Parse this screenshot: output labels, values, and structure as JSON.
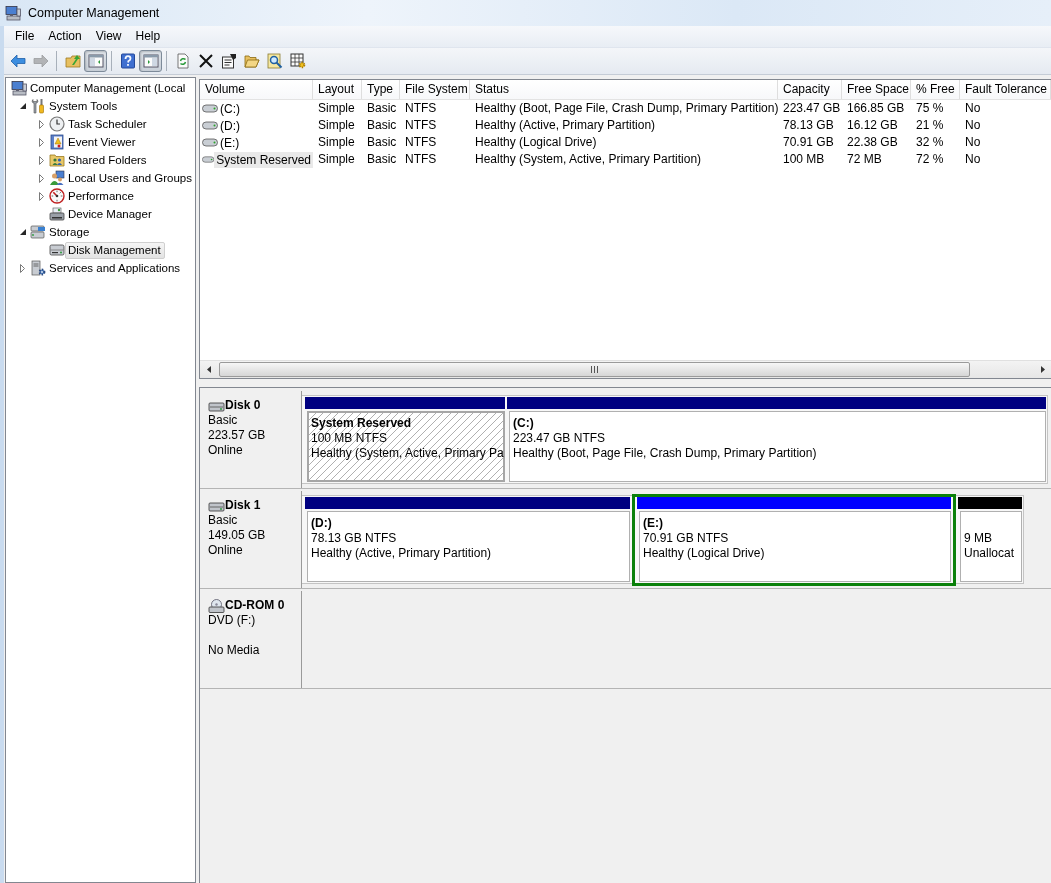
{
  "window": {
    "title": "Computer Management"
  },
  "menu": [
    "File",
    "Action",
    "View",
    "Help"
  ],
  "toolbar": [
    {
      "buttons": [
        {
          "pressed": false,
          "disabled": false
        },
        {
          "pressed": false,
          "disabled": true
        }
      ]
    },
    {
      "buttons": [
        {
          "pressed": false,
          "disabled": false
        },
        {
          "pressed": true,
          "disabled": false
        }
      ]
    },
    {
      "buttons": [
        {
          "pressed": false,
          "disabled": false
        },
        {
          "pressed": true,
          "disabled": false
        }
      ]
    },
    {
      "buttons": [
        {
          "pressed": false,
          "disabled": false
        },
        {
          "pressed": false,
          "disabled": false
        },
        {
          "pressed": false,
          "disabled": false
        },
        {
          "pressed": false,
          "disabled": false
        },
        {
          "pressed": false,
          "disabled": false
        },
        {
          "pressed": false,
          "disabled": false
        }
      ]
    }
  ],
  "tree": [
    {
      "label": "Computer Management (Local",
      "kind": "computer",
      "selected": false,
      "children": [
        {
          "label": "System Tools",
          "kind": "tools",
          "expanded": true,
          "selected": false,
          "children": [
            {
              "label": "Task Scheduler",
              "kind": "clock",
              "expanded": false,
              "selected": false
            },
            {
              "label": "Event Viewer",
              "kind": "log",
              "expanded": false,
              "selected": false
            },
            {
              "label": "Shared Folders",
              "kind": "shared-folder",
              "expanded": false,
              "selected": false
            },
            {
              "label": "Local Users and Groups",
              "kind": "users",
              "expanded": false,
              "selected": false
            },
            {
              "label": "Performance",
              "kind": "gauge",
              "expanded": false,
              "selected": false
            },
            {
              "label": "Device Manager",
              "kind": "device",
              "selected": false
            }
          ]
        },
        {
          "label": "Storage",
          "kind": "storage",
          "expanded": true,
          "selected": false,
          "children": [
            {
              "label": "Disk Management",
              "kind": "disk",
              "selected": true
            }
          ]
        },
        {
          "label": "Services and Applications",
          "kind": "services",
          "expanded": false,
          "selected": false
        }
      ]
    }
  ],
  "volume_list": {
    "columns": [
      "Volume",
      "Layout",
      "Type",
      "File System",
      "Status",
      "Capacity",
      "Free Space",
      "% Free",
      "Fault Tolerance"
    ],
    "rows": [
      {
        "selected": false,
        "cells": [
          "(C:)",
          "Simple",
          "Basic",
          "NTFS",
          "Healthy (Boot, Page File, Crash Dump, Primary Partition)",
          "223.47 GB",
          "166.85 GB",
          "75 %",
          "No"
        ]
      },
      {
        "selected": false,
        "cells": [
          "(D:)",
          "Simple",
          "Basic",
          "NTFS",
          "Healthy (Active, Primary Partition)",
          "78.13 GB",
          "16.12 GB",
          "21 %",
          "No"
        ]
      },
      {
        "selected": false,
        "cells": [
          "(E:)",
          "Simple",
          "Basic",
          "NTFS",
          "Healthy (Logical Drive)",
          "70.91 GB",
          "22.38 GB",
          "32 %",
          "No"
        ]
      },
      {
        "selected": true,
        "cells": [
          "System Reserved",
          "Simple",
          "Basic",
          "NTFS",
          "Healthy (System, Active, Primary Partition)",
          "100 MB",
          "72 MB",
          "72 %",
          "No"
        ]
      }
    ]
  },
  "disk_map": {
    "disks": [
      {
        "kind": "disk",
        "name": "Disk 0",
        "type": "Basic",
        "size": "223.57 GB",
        "status": "Online",
        "partitions": [
          {
            "kind": "primary",
            "color": "#000080",
            "selected": true,
            "name": "System Reserved",
            "size": "100 MB NTFS",
            "status": "Healthy (System, Active, Primary Pa"
          },
          {
            "kind": "primary",
            "color": "#000080",
            "selected": false,
            "name": "(C:)",
            "size": "223.47 GB NTFS",
            "status": "Healthy (Boot, Page File, Crash Dump, Primary Partition)"
          }
        ]
      },
      {
        "kind": "disk",
        "name": "Disk 1",
        "type": "Basic",
        "size": "149.05 GB",
        "status": "Online",
        "partitions": [
          {
            "kind": "primary",
            "color": "#000080",
            "selected": false,
            "name": "(D:)",
            "size": "78.13 GB NTFS",
            "status": "Healthy (Active, Primary Partition)"
          },
          {
            "kind": "logical",
            "color": "#0000ff",
            "selected": false,
            "name": "(E:)",
            "size": "70.91 GB NTFS",
            "status": "Healthy (Logical Drive)"
          },
          {
            "kind": "unallocated",
            "color": "#000000",
            "selected": false,
            "size": "9 MB",
            "status": "Unallocat"
          }
        ]
      },
      {
        "kind": "cdrom",
        "name": "CD-ROM 0",
        "type": "DVD (F:)",
        "status": "No Media"
      }
    ]
  }
}
